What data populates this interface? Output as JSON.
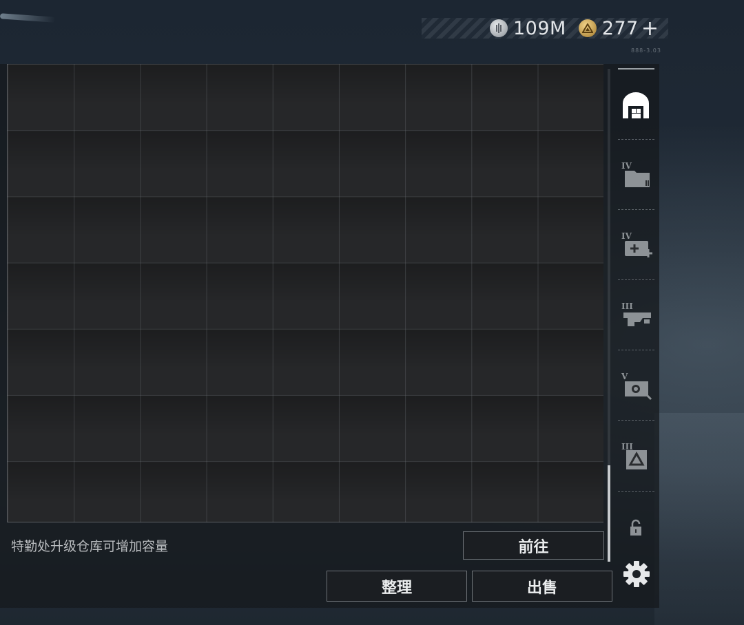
{
  "currencies": [
    {
      "name": "silver-coin",
      "icon": "silver-coin-icon",
      "value": "109M"
    },
    {
      "name": "gold-triangle",
      "icon": "gold-triangle-coin-icon",
      "value": "277"
    }
  ],
  "currency_add": "+",
  "build_code": "888-3.03",
  "hint_text": "特勤处升级仓库可增加容量",
  "buttons": {
    "goto": "前往",
    "sort": "整理",
    "sell": "出售"
  },
  "sidebar_tabs": [
    {
      "id": "warehouse",
      "icon": "warehouse-icon",
      "tier": "",
      "active": true
    },
    {
      "id": "tier-iv-folder",
      "icon": "folder-icon",
      "tier": "IV",
      "active": false
    },
    {
      "id": "tier-iv-medkit",
      "icon": "medkit-plus-icon",
      "tier": "IV",
      "active": false
    },
    {
      "id": "tier-iii-weapon",
      "icon": "gun-icon",
      "tier": "III",
      "active": false
    },
    {
      "id": "tier-v-safe",
      "icon": "safe-icon",
      "tier": "V",
      "active": false
    },
    {
      "id": "tier-iii-card",
      "icon": "triangle-card-icon",
      "tier": "III",
      "active": false
    }
  ],
  "colors": {
    "accent": "#ffffff",
    "inactive_icon": "#8d9296",
    "panel_bg": "#262729"
  }
}
